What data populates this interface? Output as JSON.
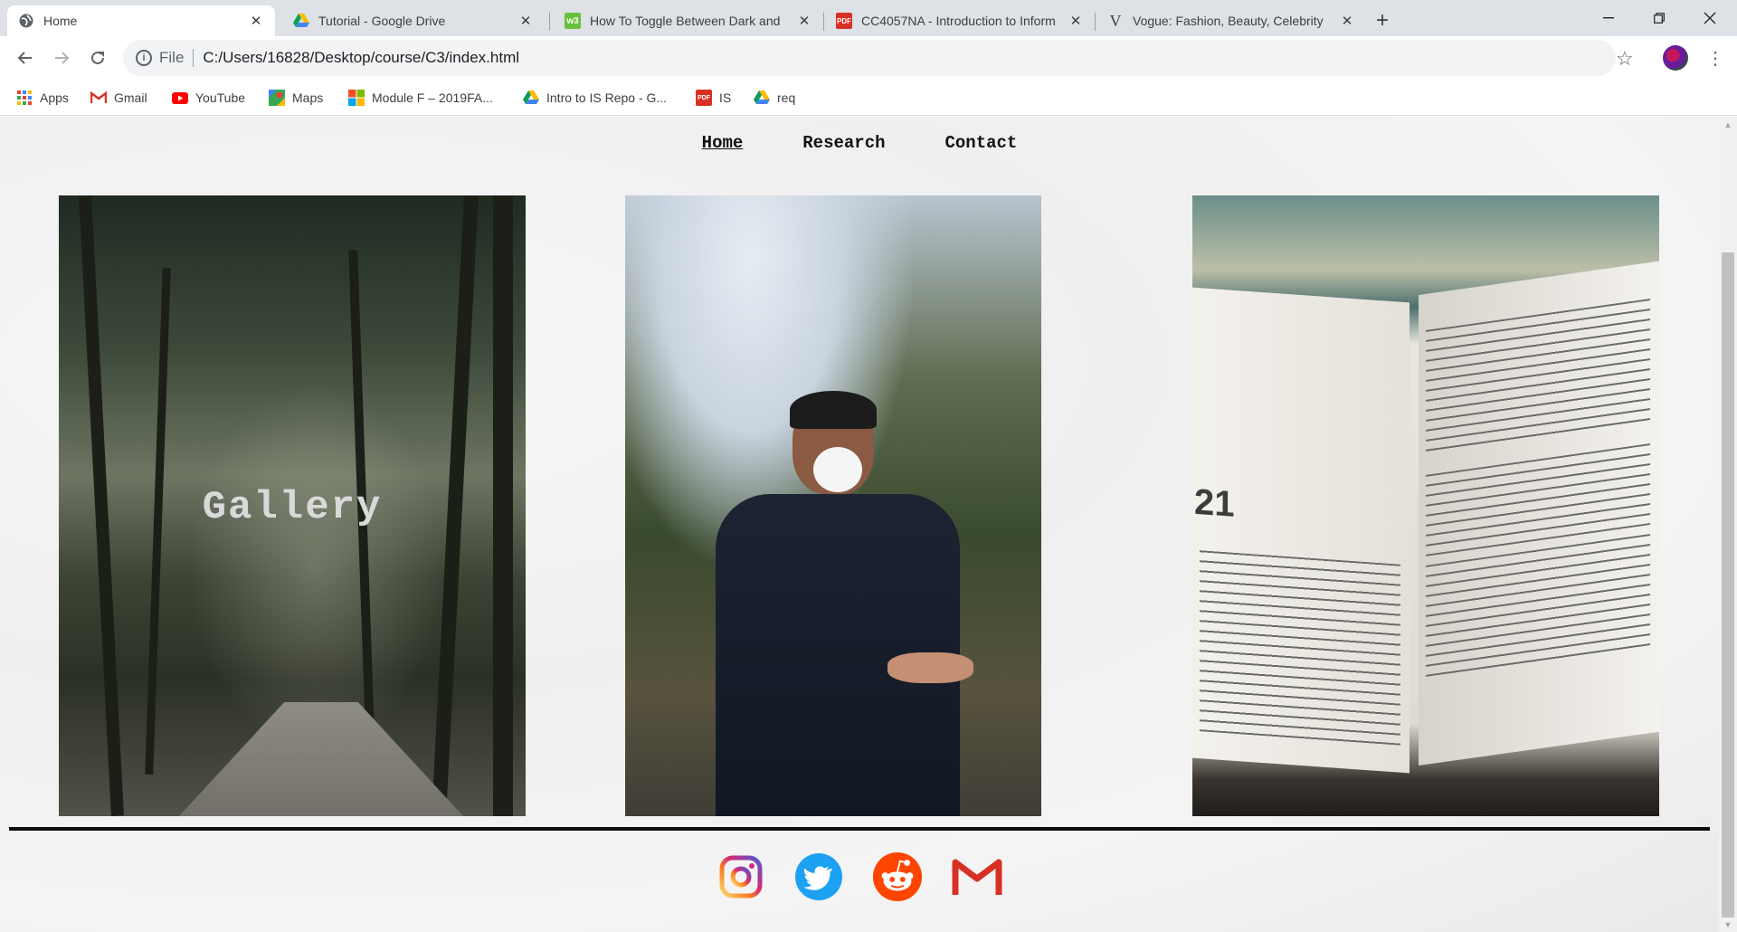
{
  "browser": {
    "tabs": [
      {
        "title": "Home",
        "icon": "globe-icon",
        "active": true
      },
      {
        "title": "Tutorial - Google Drive",
        "icon": "google-drive-icon",
        "active": false
      },
      {
        "title": "How To Toggle Between Dark and",
        "icon": "w3schools-icon",
        "active": false
      },
      {
        "title": "CC4057NA - Introduction to Inform",
        "icon": "pdf-icon",
        "active": false
      },
      {
        "title": "Vogue: Fashion, Beauty, Celebrity",
        "icon": "vogue-icon",
        "active": false
      }
    ],
    "url_scheme": "File",
    "url": "C:/Users/16828/Desktop/course/C3/index.html",
    "bookmarks": [
      {
        "label": "Apps",
        "icon": "apps-grid-icon"
      },
      {
        "label": "Gmail",
        "icon": "gmail-icon"
      },
      {
        "label": "YouTube",
        "icon": "youtube-icon"
      },
      {
        "label": "Maps",
        "icon": "maps-icon"
      },
      {
        "label": "Module F – 2019FA...",
        "icon": "microsoft-icon"
      },
      {
        "label": "Intro to IS Repo - G...",
        "icon": "google-drive-icon"
      },
      {
        "label": "IS",
        "icon": "pdf-icon"
      },
      {
        "label": "req",
        "icon": "google-drive-icon"
      }
    ]
  },
  "site": {
    "nav": [
      {
        "label": "Home",
        "current": true
      },
      {
        "label": "Research",
        "current": false
      },
      {
        "label": "Contact",
        "current": false
      }
    ],
    "gallery_title": "Gallery",
    "book_page_number": "21",
    "social": [
      "instagram-icon",
      "twitter-icon",
      "reddit-icon",
      "gmail-icon"
    ]
  },
  "colors": {
    "instagram": "#e1306c",
    "twitter": "#1da1f2",
    "reddit": "#ff4500",
    "gmail": "#d93025"
  }
}
